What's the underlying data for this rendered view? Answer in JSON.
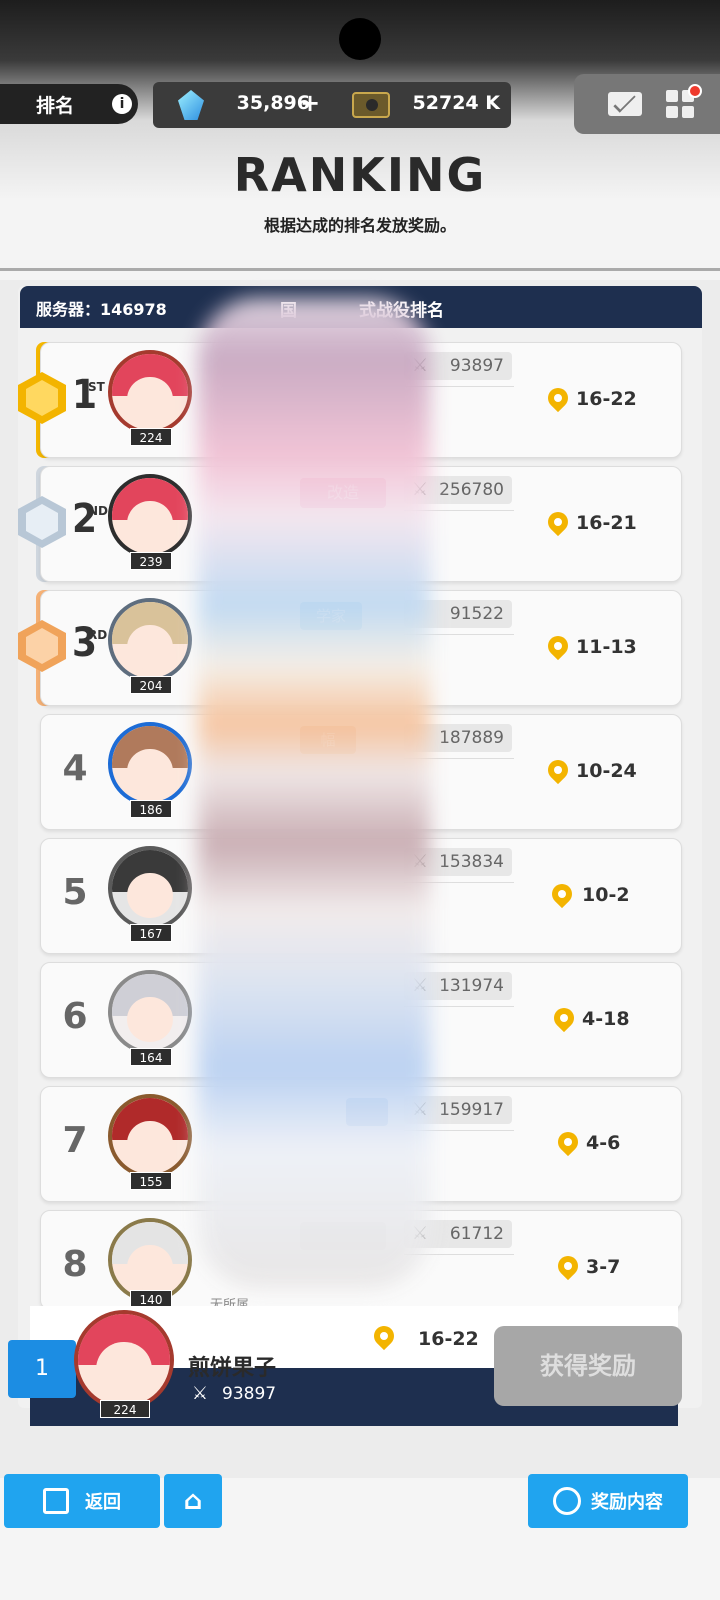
{
  "header": {
    "title": "排名",
    "info_icon": "info-icon",
    "gem_value": "35,896",
    "ticket_value": "52724 K"
  },
  "banner": {
    "title": "RANKING",
    "subtitle": "根据达成的排名发放奖励。"
  },
  "board": {
    "server_label": "服务器：146978",
    "title": "国",
    "title_tail": "式战役排名"
  },
  "rows": [
    {
      "rank": "1",
      "suffix": "ST",
      "level": "224",
      "power": "93897",
      "stage": "16-22"
    },
    {
      "rank": "2",
      "suffix": "ND",
      "level": "239",
      "power": "256780",
      "stage": "16-21",
      "tag": "改造"
    },
    {
      "rank": "3",
      "suffix": "RD",
      "level": "204",
      "power": "91522",
      "stage": "11-13",
      "tag": "学家"
    },
    {
      "rank": "4",
      "level": "186",
      "power": "187889",
      "stage": "10-24",
      "tag": "幅"
    },
    {
      "rank": "5",
      "level": "167",
      "power": "153834",
      "stage": "10-2"
    },
    {
      "rank": "6",
      "level": "164",
      "power": "131974",
      "stage": "4-18"
    },
    {
      "rank": "7",
      "level": "155",
      "power": "159917",
      "stage": "4-6"
    },
    {
      "rank": "8",
      "level": "140",
      "power": "61712",
      "stage": "3-7",
      "note": "无所属"
    }
  ],
  "self": {
    "rank": "1",
    "name": "煎饼果子",
    "stage": "16-22",
    "level": "224",
    "power": "93897",
    "claim_label": "获得奖励"
  },
  "nav": {
    "back_label": "返回",
    "reward_label": "奖励内容"
  },
  "colors": {
    "accent": "#20a4ef",
    "board_head": "#1e2f4f",
    "gold": "#f3b400",
    "silver": "#b8c7d6",
    "bronze": "#f0a35a"
  }
}
